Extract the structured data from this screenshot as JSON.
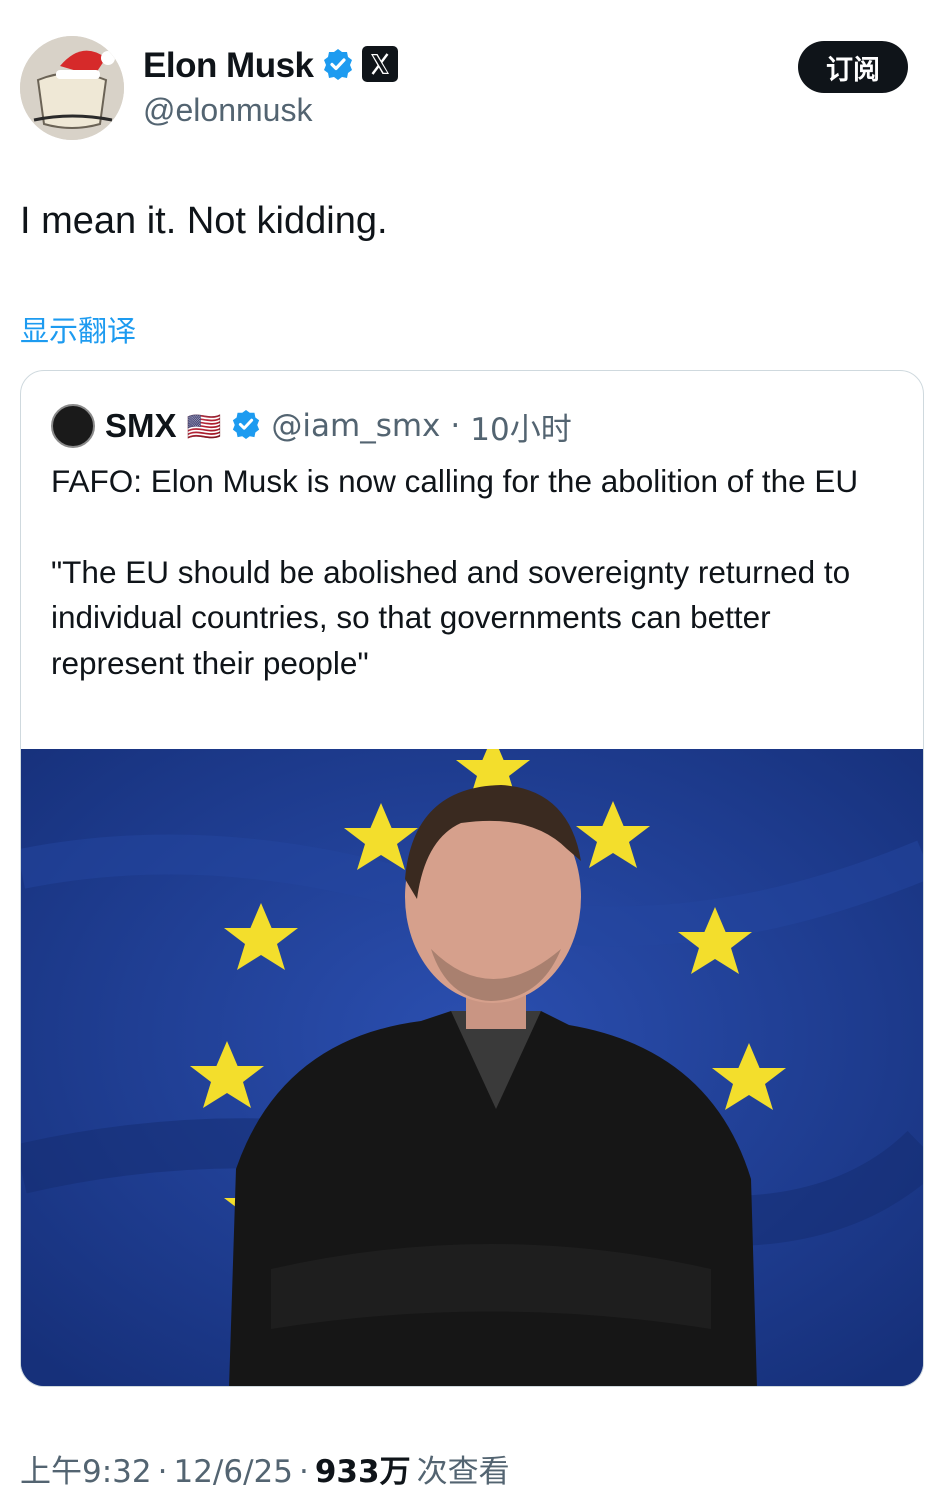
{
  "author": {
    "name": "Elon Musk",
    "handle": "@elonmusk",
    "avatar_icon": "avatar-santa-hat",
    "verified_icon": "verified-badge-icon",
    "affiliate_icon": "x-logo-icon"
  },
  "subscribe_label": "订阅",
  "tweet": {
    "text": "I mean it. Not kidding.",
    "translate_label": "显示翻译"
  },
  "quote": {
    "name": "SMX",
    "flag": "🇺🇸",
    "handle": "@iam_smx",
    "separator": "·",
    "time": "10小时",
    "line1": "FAFO: Elon Musk is now calling for the abolition of the EU",
    "line2": "\"The EU should be abolished and sovereignty returned to individual countries, so that governments can better represent their people\"",
    "image_icon": "eu-flag-photo"
  },
  "meta": {
    "time": "上午9:32",
    "sep1": "·",
    "date": "12/6/25",
    "sep2": "·",
    "views": "933万",
    "views_label": "次查看"
  },
  "colors": {
    "accent": "#1d9bf0",
    "text": "#0f1419",
    "secondary": "#536471",
    "eu_blue": "#1f3d8f",
    "eu_star": "#f3de2c"
  }
}
